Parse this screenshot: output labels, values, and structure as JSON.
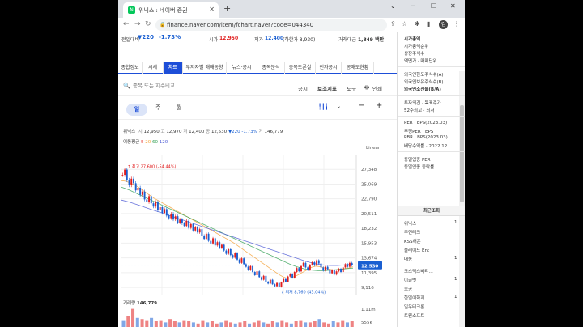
{
  "browser": {
    "tab_title": "위닉스 : 네이버 증권",
    "url": "finance.naver.com/item/fchart.naver?code=044340",
    "profile_initial": "김"
  },
  "stock_header": {
    "change_label": "전일대비",
    "change_value": "▼220",
    "change_pct": "-1.73%",
    "high_label": "시가",
    "high_value": "12,950",
    "low_label": "저가",
    "low_value": "12,400",
    "lower_limit": "(하한가 8,930)",
    "trade_label": "거래대금",
    "trade_value": "1,849 백만"
  },
  "subtabs": [
    "종합정보",
    "시세",
    "차트",
    "투자자별 매매동향",
    "뉴스·공시",
    "종목분석",
    "종목토론실",
    "전자공시",
    "공매도현황"
  ],
  "search": {
    "placeholder": "종목 또는 지수비교",
    "btn_notice": "공시",
    "btn_indicator": "보조지표",
    "btn_tools": "도구",
    "btn_print": "인쇄"
  },
  "periods": [
    "일",
    "주",
    "월"
  ],
  "ohlc": {
    "name": "위닉스",
    "open_l": "시",
    "open": "12,950",
    "high_l": "고",
    "high": "12,970",
    "low_l": "저",
    "low": "12,400",
    "close_l": "종",
    "close": "12,530",
    "change": "▼220",
    "pct": "-1.73%",
    "vol_l": "거",
    "vol": "146,779"
  },
  "moving_avg": {
    "label": "이동평균",
    "p5": "5",
    "p20": "20",
    "p60": "60",
    "p120": "120",
    "color5": "#e8423b",
    "color20": "#f4a23a",
    "color60": "#3aa35a",
    "color120": "#4d5bd5"
  },
  "scale": "Linear",
  "volume": {
    "label": "거래량",
    "value": "146,779",
    "axis_label": "1.11m",
    "axis_label2": "555k"
  },
  "chart_data": {
    "type": "line",
    "yticks": [
      27348,
      25069,
      22790,
      20511,
      18232,
      15953,
      13674,
      11395,
      9116
    ],
    "ylim": [
      8000,
      29500
    ],
    "current_price": 12530,
    "current_label": "12,530",
    "max_label": "최고 27,600 (-54.44%)",
    "min_label": "최저 8,760 (43.04%)",
    "accent": "#1d4ed8",
    "up_color": "#e01e1e",
    "down_color": "#1a5fd1",
    "series": [
      {
        "values": [
          26500,
          27300,
          25700,
          24900,
          25900,
          25200,
          24100,
          24500,
          23400,
          23900,
          22700,
          22300,
          23200,
          22100,
          21600,
          22300,
          21000,
          21500,
          20600,
          21200,
          20200,
          19800,
          20500,
          19600,
          20100,
          19100,
          19600,
          19000,
          18600,
          19400,
          18300,
          18900,
          17900,
          18400,
          17600,
          18100,
          17100,
          16600,
          17400,
          16300,
          15900,
          16700,
          15600,
          16100,
          15200,
          15700,
          14800,
          14300,
          15000,
          14100,
          13700,
          14400,
          13400,
          12900,
          13600,
          12700,
          12300,
          11800,
          12400,
          11500,
          11000,
          11600,
          10700,
          10300,
          10900,
          10000,
          9700,
          10300,
          9600,
          9300,
          9800,
          9200,
          9900,
          10400,
          10000,
          10800,
          11200,
          10600,
          11500,
          12100,
          11600,
          12400,
          12900,
          12200,
          11800,
          12600,
          13000,
          12500,
          13300,
          12800,
          12200,
          11700,
          12300,
          11900,
          11300,
          11800,
          11100,
          11600,
          12000,
          11500,
          12200,
          12700,
          12300,
          12900,
          12500
        ]
      },
      {
        "values": [
          25600,
          25500,
          25200,
          24900,
          24400,
          23900,
          23400,
          22900,
          22500,
          22100,
          21700,
          21300,
          20900,
          20500,
          20100,
          19700,
          19300,
          18900,
          18500,
          18100,
          17700,
          17300,
          16900,
          16500,
          16100,
          15600,
          15100,
          14600,
          14100,
          13600,
          13100,
          12600,
          12100,
          11600,
          11100,
          10700,
          10500,
          10700,
          11000,
          11400,
          11800,
          12200,
          12400,
          12300,
          12100,
          11900,
          11800,
          11900,
          12000,
          12100,
          12300
        ]
      },
      {
        "values": [
          24600,
          24200,
          23700,
          23200,
          22700,
          22200,
          21700,
          21200,
          20700,
          20200,
          19700,
          19200,
          18700,
          18200,
          17700,
          17200,
          16700,
          16200,
          15700,
          15200,
          14700,
          14200,
          13700,
          13200,
          12700,
          12300,
          12000,
          11800,
          11700,
          11700,
          11800,
          11900,
          12000,
          12100
        ]
      },
      {
        "values": [
          22600,
          22300,
          21900,
          21500,
          21100,
          20700,
          20300,
          19900,
          19500,
          19100,
          18700,
          18300,
          17900,
          17500,
          17100,
          16700,
          16300,
          15900,
          15500,
          15100,
          14700,
          14300,
          13900,
          13500,
          13100,
          12800,
          12600,
          12500,
          12500,
          12600,
          12700
        ]
      }
    ],
    "volume": [
      0.3,
      0.5,
      0.8,
      0.4,
      0.35,
      0.3,
      0.4,
      0.25,
      0.3,
      0.2,
      0.35,
      0.25,
      0.2,
      0.3,
      0.25,
      0.2,
      0.15,
      0.3,
      0.2,
      0.25,
      0.15,
      0.2,
      0.3,
      0.2,
      0.15,
      0.2,
      0.25,
      0.15,
      0.2,
      0.3,
      0.2,
      0.15,
      0.25,
      0.2,
      0.3,
      0.2,
      0.15,
      0.25,
      0.3,
      0.2,
      0.2,
      0.25,
      0.35,
      0.2,
      0.15,
      0.25,
      0.2,
      0.3,
      0.2,
      0.25
    ]
  },
  "right_panel": {
    "items1": [
      "시가총액",
      "시가총액순위",
      "상장주식수",
      "액면가 · 매매단위"
    ],
    "items2": [
      "외국인한도주식수(A)",
      "외국인보유주식수(B)",
      "외국인소진율(B/A)"
    ],
    "items3": [
      "투자의견 · 목표주가",
      "52주최고 · 최저"
    ],
    "items4": [
      "PER · EPS(2023.03)",
      "추정PER · EPS",
      "PBR · BPS(2023.03)",
      "배당수익률 · 2022.12"
    ],
    "items5": [
      "동일업종 PER",
      "동일업종 등락률"
    ],
    "recent_title": "최근조회",
    "recent": [
      {
        "name": "위닉스",
        "num": "1"
      },
      {
        "name": "주연테크",
        "num": ""
      },
      {
        "name": "KSS해운",
        "num": ""
      },
      {
        "name": "블레이드 Ent",
        "num": ""
      },
      {
        "name": "대동",
        "num": "1"
      },
      {
        "name": "코스맥스비티…",
        "num": ""
      },
      {
        "name": "이글벳",
        "num": "1"
      },
      {
        "name": "오공",
        "num": ""
      },
      {
        "name": "한일이화지",
        "num": "1"
      },
      {
        "name": "일우테크론",
        "num": ""
      },
      {
        "name": "트윈소프트",
        "num": ""
      }
    ]
  }
}
